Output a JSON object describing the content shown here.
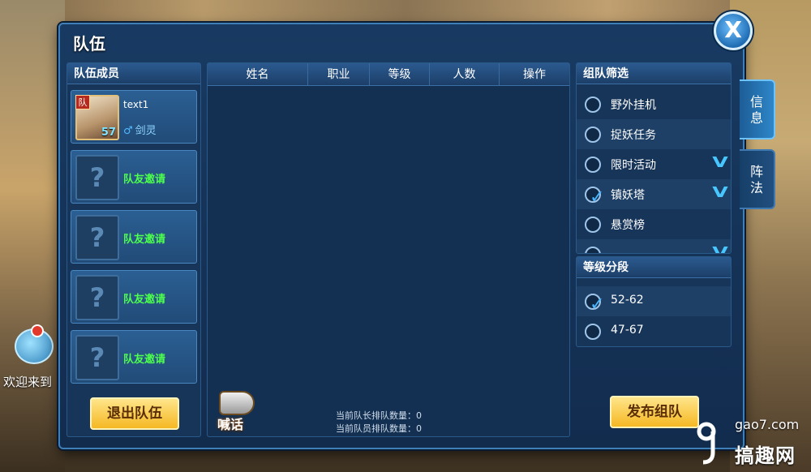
{
  "window": {
    "title": "队伍"
  },
  "close_button": {
    "label": "X"
  },
  "left_panel": {
    "header": "队伍成员",
    "members": [
      {
        "name": "text1",
        "gender": "♂",
        "class": "剑灵",
        "level": "57",
        "badge": "队"
      }
    ],
    "empty_slots": [
      {
        "label": "队友邀请",
        "icon_glyph": "?"
      },
      {
        "label": "队友邀请",
        "icon_glyph": "?"
      },
      {
        "label": "队友邀请",
        "icon_glyph": "?"
      },
      {
        "label": "队友邀请",
        "icon_glyph": "?"
      }
    ],
    "leave_button": "退出队伍"
  },
  "list_panel": {
    "columns": [
      "姓名",
      "职业",
      "等级",
      "人数",
      "操作"
    ],
    "rows": [],
    "shout_button": "喊话",
    "queue_leader": "当前队长排队数量：0",
    "queue_member": "当前队员排队数量：0"
  },
  "filter_panel": {
    "header": "组队筛选",
    "items": [
      {
        "label": "野外挂机",
        "checked": false,
        "expandable": false
      },
      {
        "label": "捉妖任务",
        "checked": false,
        "expandable": false
      },
      {
        "label": "限时活动",
        "checked": false,
        "expandable": true
      },
      {
        "label": "镇妖塔",
        "checked": true,
        "expandable": true
      },
      {
        "label": "悬赏榜",
        "checked": false,
        "expandable": false
      }
    ]
  },
  "level_panel": {
    "header": "等级分段",
    "items": [
      {
        "label": "52-62",
        "checked": true
      },
      {
        "label": "47-67",
        "checked": false
      }
    ]
  },
  "publish_button": "发布组队",
  "side_tabs": [
    {
      "label_top": "信",
      "label_bottom": "息",
      "active": true
    },
    {
      "label_top": "阵",
      "label_bottom": "法",
      "active": false
    }
  ],
  "background": {
    "chat_text": "欢迎来到"
  },
  "watermark": {
    "url": "gao7.com",
    "name": "搞趣网"
  }
}
